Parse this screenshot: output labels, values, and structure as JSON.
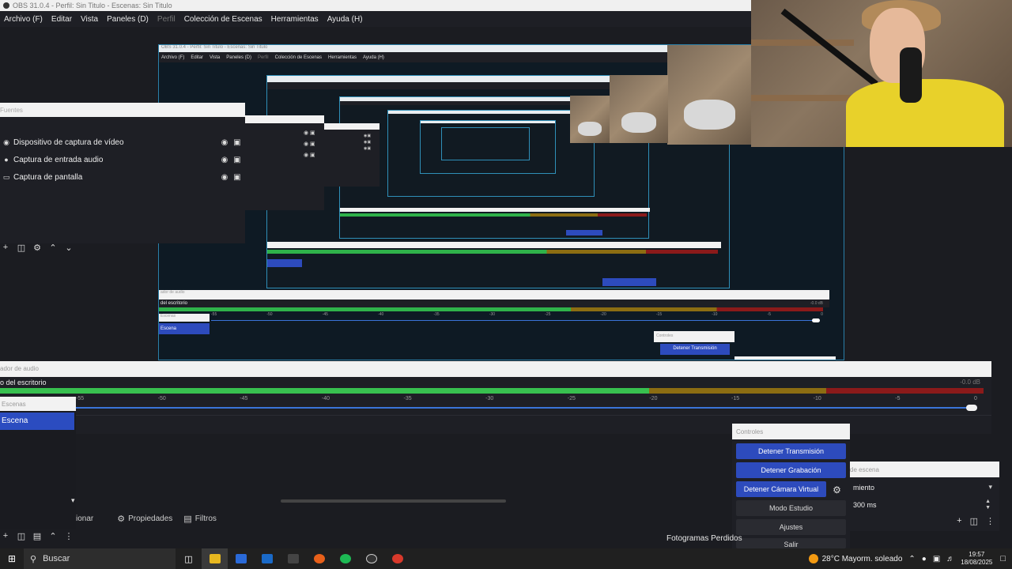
{
  "window": {
    "title": "OBS 31.0.4 - Perfil: Sin Titulo - Escenas: Sin Titulo"
  },
  "menu": {
    "items": [
      "Archivo (F)",
      "Editar",
      "Vista",
      "Paneles (D)",
      "Perfil",
      "Colección de Escenas",
      "Herramientas",
      "Ayuda (H)"
    ]
  },
  "sources": {
    "header": "Fuentes",
    "items": [
      {
        "label": "Dispositivo de captura de vídeo",
        "icon": "camera-icon"
      },
      {
        "label": "Captura de entrada audio",
        "icon": "microphone-icon"
      },
      {
        "label": "Captura de pantalla",
        "icon": "monitor-icon"
      }
    ]
  },
  "mixer": {
    "header": "ador de audio",
    "channel": "o del escritorio",
    "db": "-0.0 dB",
    "ticks": [
      "-55",
      "-50",
      "-45",
      "-40",
      "-35",
      "-30",
      "-25",
      "-20",
      "-15",
      "-10",
      "-5",
      "0"
    ]
  },
  "scenes": {
    "header": "Escenas",
    "items": [
      "Escena"
    ]
  },
  "bottom_toolbar": {
    "partial": "ionar",
    "properties": "Propiedades",
    "filters": "Filtros"
  },
  "controls": {
    "header": "Controles",
    "stop_stream": "Detener Transmisión",
    "stop_record": "Detener Grabación",
    "stop_virtual_cam": "Detener Cámara Virtual",
    "studio_mode": "Modo Estudio",
    "settings": "Ajustes",
    "exit": "Salir"
  },
  "transitions": {
    "header": "de escena",
    "selected": "miento",
    "duration": "300 ms"
  },
  "status": {
    "dropped_frames": "Fotogramas Perdidos"
  },
  "nested": {
    "title": "OBS 31.0.4 - Perfil: Sin Titulo - Escenas: Sin Titulo",
    "menu": [
      "Archivo (F)",
      "Editar",
      "Vista",
      "Paneles (D)",
      "Perfil",
      "Colección de Escenas",
      "Herramientas",
      "Ayuda (H)"
    ],
    "mixer_label": "ador de audio",
    "channel": "del escritorio",
    "db": "-0.0 dB",
    "scene": "Escena",
    "scenes_header": "Escenas",
    "controls_header": "Controles",
    "stop_stream": "Detener Transmisión",
    "ticks": [
      "-55",
      "-50",
      "-45",
      "-40",
      "-35",
      "-30",
      "-25",
      "-20",
      "-15",
      "-10",
      "-5",
      "0"
    ]
  },
  "taskbar": {
    "search": "Buscar",
    "weather_temp": "28°C",
    "weather_text": "Mayorm. soleado",
    "time": "19:57",
    "date": "18/08/2025"
  },
  "colors": {
    "accent_blue": "#2d4bbd",
    "meter_green": "#38c04f",
    "meter_yellow": "#8c6d12",
    "meter_red": "#8b1a1a"
  }
}
